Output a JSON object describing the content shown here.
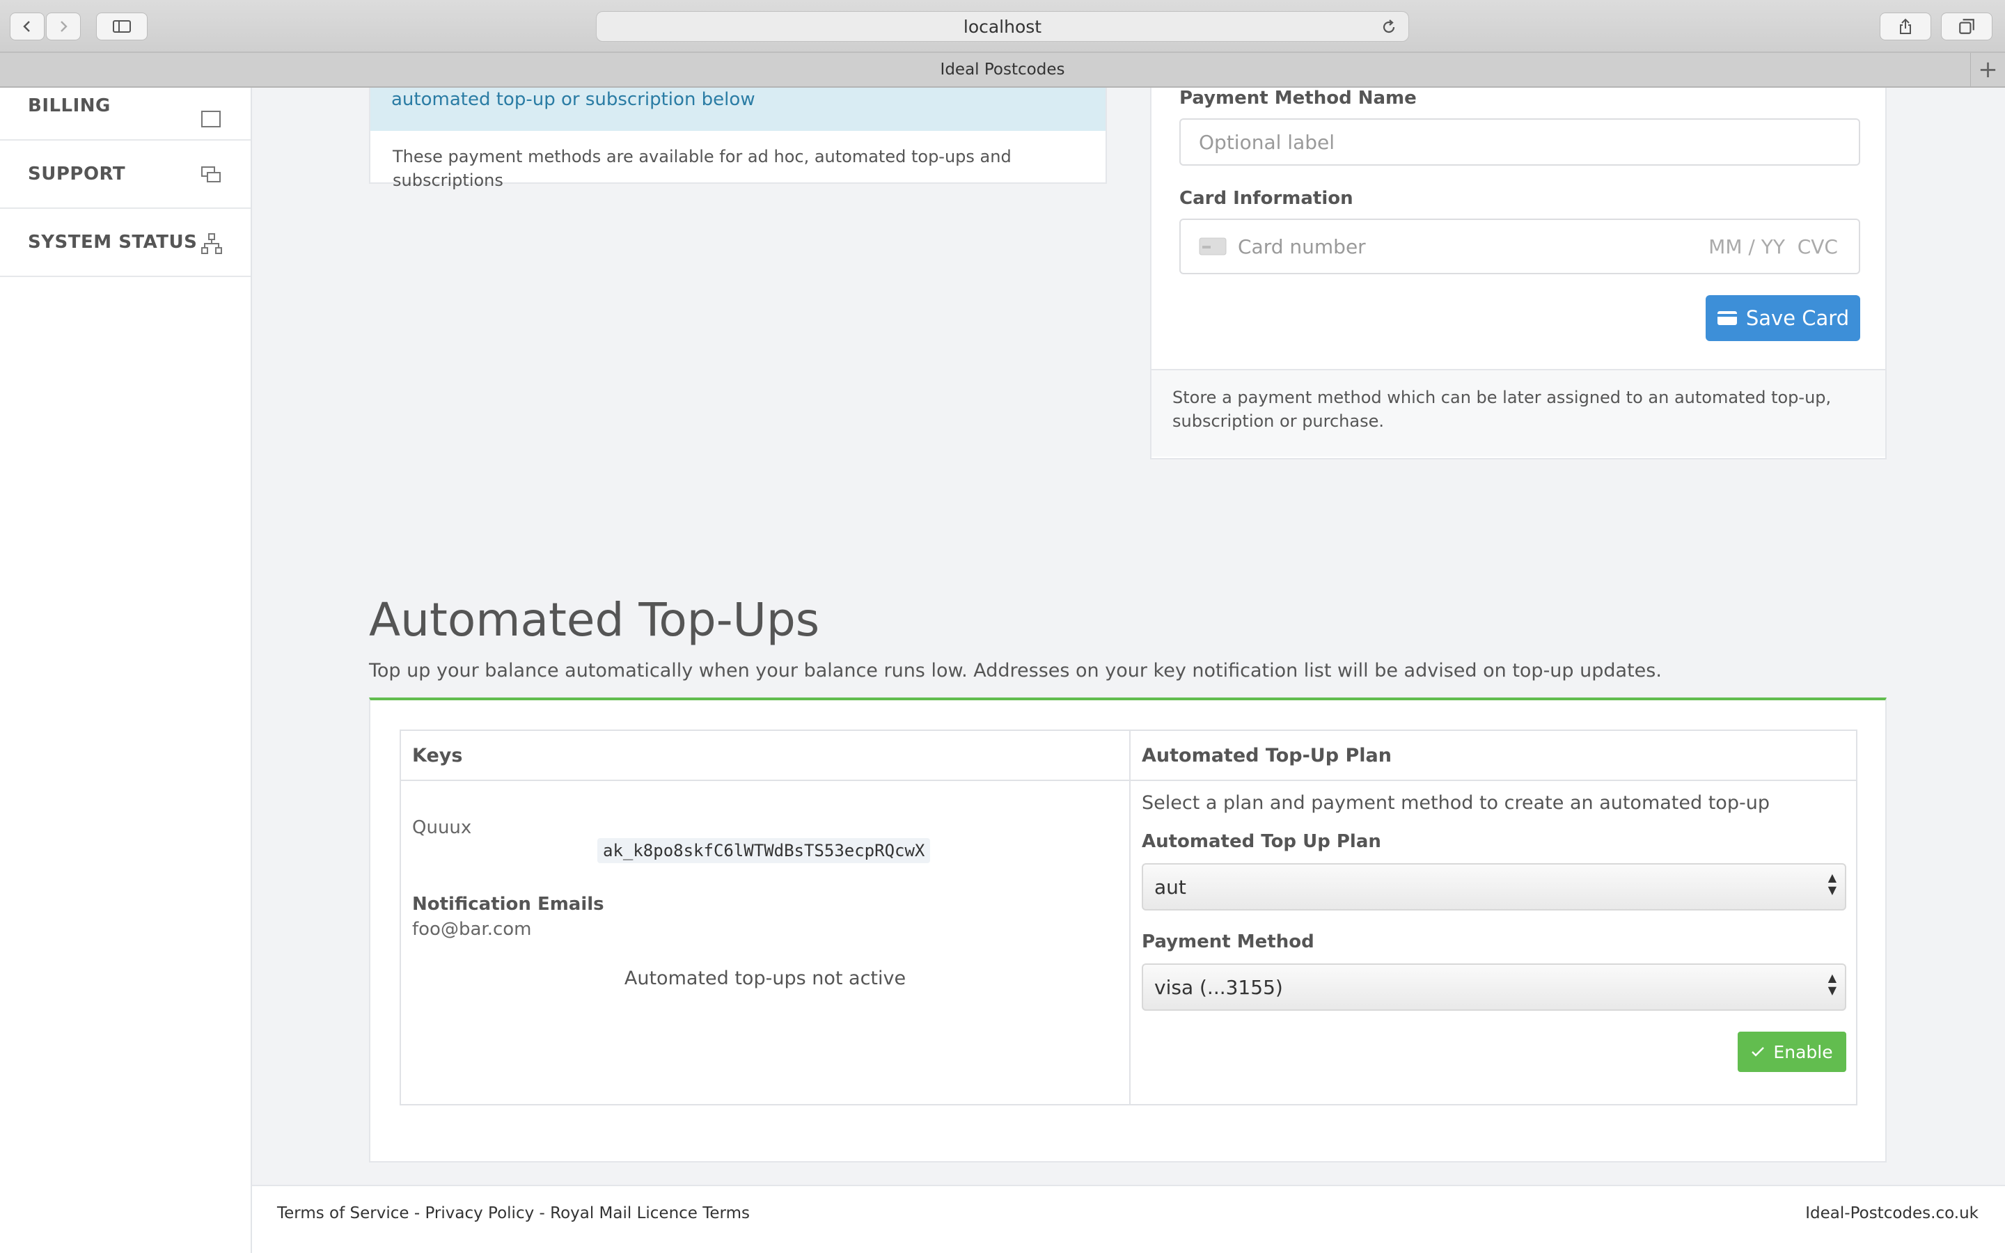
{
  "browser": {
    "url": "localhost",
    "tab_title": "Ideal Postcodes"
  },
  "sidebar": {
    "items": [
      {
        "label": "BILLING",
        "icon": "billing-icon"
      },
      {
        "label": "SUPPORT",
        "icon": "chat-icon"
      },
      {
        "label": "SYSTEM STATUS",
        "icon": "sitemap-icon"
      }
    ]
  },
  "payment_methods_card": {
    "alert_text": "automated top-up or subscription below",
    "help_text": "These payment methods are available for ad hoc, automated top-ups and subscriptions"
  },
  "add_card": {
    "name_label": "Payment Method Name",
    "name_placeholder": "Optional label",
    "card_label": "Card Information",
    "card_number_placeholder": "Card number",
    "expiry_cvc_placeholder": "MM / YY  CVC",
    "save_button": "Save Card",
    "help_text": "Store a payment method which can be later assigned to an automated top-up, subscription or purchase."
  },
  "automated_topups": {
    "title": "Automated Top-Ups",
    "description": "Top up your balance automatically when your balance runs low. Addresses on your key notification list will be advised on top-up updates.",
    "keys_header": "Keys",
    "plan_header": "Automated Top-Up Plan",
    "key_name": "Quuux",
    "key_value": "ak_k8po8skfC6lWTWdBsTS53ecpRQcwX",
    "notification_label": "Notification Emails",
    "notification_email": "foo@bar.com",
    "status": "Automated top-ups not active",
    "plan_intro": "Select a plan and payment method to create an automated top-up",
    "plan_label": "Automated Top Up Plan",
    "plan_value": "aut",
    "payment_label": "Payment Method",
    "payment_value": "visa (...3155)",
    "enable_button": "Enable"
  },
  "footer": {
    "terms": "Terms of Service",
    "sep1": " - ",
    "privacy": "Privacy Policy",
    "sep2": " - ",
    "licence": "Royal Mail Licence Terms",
    "brand": "Ideal-Postcodes.co.uk"
  },
  "colors": {
    "accent_blue": "#3d8fd8",
    "success_green": "#62bd4f",
    "alert_bg": "#d9ecf3"
  }
}
